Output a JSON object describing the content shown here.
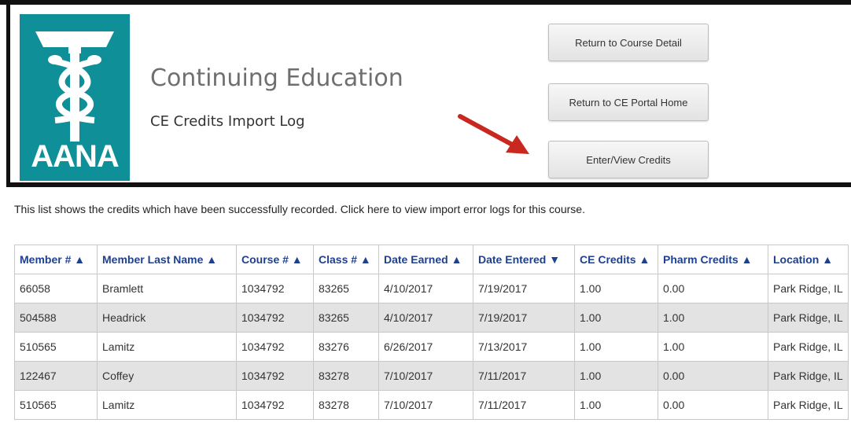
{
  "header": {
    "logo_text": "AANA",
    "title": "Continuing Education",
    "subtitle": "CE Credits Import Log"
  },
  "buttons": {
    "return_course_detail": "Return to Course Detail",
    "return_portal_home": "Return to CE Portal Home",
    "enter_view_credits": "Enter/View Credits"
  },
  "info_text": "This list shows the credits which have been successfully recorded. Click here to view import error logs for this course.",
  "table": {
    "headers": [
      "Member # ▲",
      "Member Last Name ▲",
      "Course # ▲",
      "Class # ▲",
      "Date Earned ▲",
      "Date Entered ▼",
      "CE Credits ▲",
      "Pharm Credits ▲",
      "Location ▲"
    ],
    "rows": [
      [
        "66058",
        "Bramlett",
        "1034792",
        "83265",
        "4/10/2017",
        "7/19/2017",
        "1.00",
        "0.00",
        "Park Ridge, IL"
      ],
      [
        "504588",
        "Headrick",
        "1034792",
        "83265",
        "4/10/2017",
        "7/19/2017",
        "1.00",
        "1.00",
        "Park Ridge, IL"
      ],
      [
        "510565",
        "Lamitz",
        "1034792",
        "83276",
        "6/26/2017",
        "7/13/2017",
        "1.00",
        "1.00",
        "Park Ridge, IL"
      ],
      [
        "122467",
        "Coffey",
        "1034792",
        "83278",
        "7/10/2017",
        "7/11/2017",
        "1.00",
        "0.00",
        "Park Ridge, IL"
      ],
      [
        "510565",
        "Lamitz",
        "1034792",
        "83278",
        "7/10/2017",
        "7/11/2017",
        "1.00",
        "0.00",
        "Park Ridge, IL"
      ]
    ]
  },
  "colors": {
    "logo_bg": "#0f8f98",
    "header_text": "#1f3f8f",
    "arrow": "#c8281f",
    "alt_row": "#e3e3e3"
  },
  "icons": {
    "logo": "caduceus-logo",
    "arrow": "red-arrow-icon"
  }
}
